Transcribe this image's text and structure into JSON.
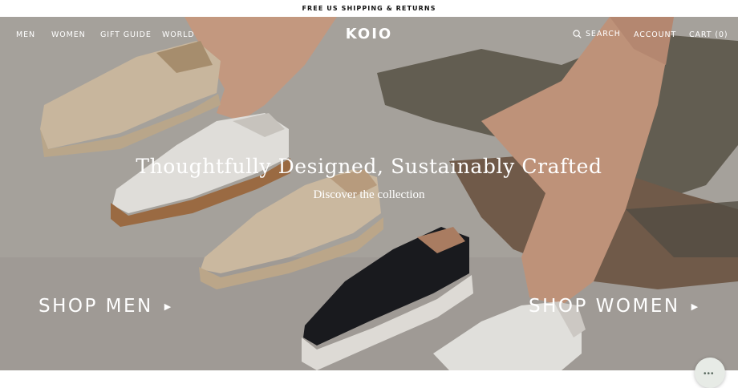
{
  "announcement": "FREE US SHIPPING & RETURNS",
  "nav_left": {
    "men": "MEN",
    "women": "WOMEN",
    "gift_guide": "GIFT GUIDE",
    "world": "WORLD"
  },
  "brand": "KOIO",
  "nav_right": {
    "search_icon": "search-icon",
    "search": "SEARCH",
    "account": "ACCOUNT",
    "cart": "CART (0)"
  },
  "hero": {
    "headline": "Thoughtfully Designed, Sustainably Crafted",
    "subline": "Discover the collection",
    "shop_men": "SHOP MEN",
    "shop_women": "SHOP WOMEN",
    "arrow_icon": "triangle-right-icon"
  },
  "chat_widget": {
    "icon": "chat-bubble-icon"
  },
  "colors": {
    "text_on_hero": "#ffffff",
    "background_floor": "#b2ada7",
    "sneaker_tan": "#d9c6ab",
    "sneaker_white": "#f2f0ec",
    "sneaker_black": "#1c1d21",
    "gum_sole": "#a87448"
  }
}
